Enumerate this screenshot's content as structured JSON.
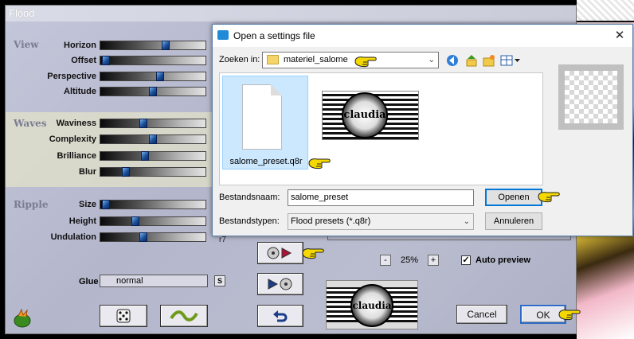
{
  "flood": {
    "title": "Flood",
    "sections": {
      "view": "View",
      "waves": "Waves",
      "ripple": "Ripple"
    },
    "sliders": [
      {
        "label": "Horizon",
        "value": 0.63
      },
      {
        "label": "Offset",
        "value": 0.02
      },
      {
        "label": "Perspective",
        "value": 0.57
      },
      {
        "label": "Altitude",
        "value": 0.5
      },
      {
        "label": "Waviness",
        "value": 0.4
      },
      {
        "label": "Complexity",
        "value": 0.5
      },
      {
        "label": "Brilliance",
        "value": 0.42
      },
      {
        "label": "Blur",
        "value": 0.22
      },
      {
        "label": "Size",
        "value": 0.02
      },
      {
        "label": "Height",
        "value": 0.32
      },
      {
        "label": "Undulation",
        "value": 0.4
      }
    ],
    "glue_label": "Glue",
    "glue_value": "normal",
    "glue_s": "S",
    "r7_label": "r7",
    "zoom": {
      "minus": "-",
      "value": "25%",
      "plus": "+"
    },
    "auto_preview": {
      "checked": true,
      "label": "Auto preview",
      "mark": "✓"
    },
    "cancel_label": "Cancel",
    "ok_label": "OK"
  },
  "dialog": {
    "title": "Open a settings file",
    "close_glyph": "✕",
    "look_in_label": "Zoeken in:",
    "look_in_value": "materiel_salome",
    "file1_name": "salome_preset.q8r",
    "logo_text": "claudia",
    "filename_label": "Bestandsnaam:",
    "filename_value": "salome_preset",
    "filetype_label": "Bestandstypen:",
    "filetype_value": "Flood presets (*.q8r)",
    "open_label": "Openen",
    "cancel_label": "Annuleren"
  },
  "colors": {
    "accent": "#0078d7",
    "hand": "#f5d800",
    "slider_thumb": "#1a4f9a"
  }
}
